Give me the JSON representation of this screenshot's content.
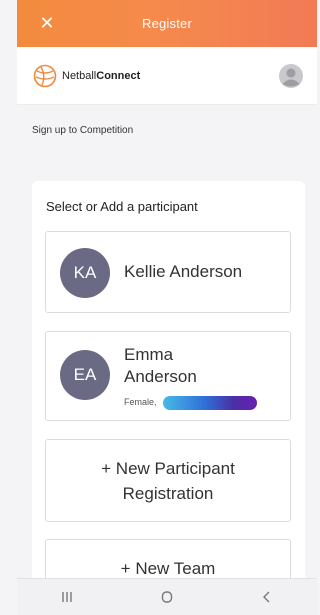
{
  "app": {
    "title": "Register",
    "close_icon": "close-icon"
  },
  "header": {
    "brand_plain": "Netball",
    "brand_bold": "Connect",
    "avatar_icon": "user-avatar-icon"
  },
  "subheading": "Sign up to Competition",
  "panel": {
    "title": "Select or Add a participant",
    "participants": [
      {
        "initials": "KA",
        "name": "Kellie Anderson",
        "avatar_color": "#6b6a85"
      },
      {
        "initials": "EA",
        "name": "Emma Anderson",
        "gender": "Female,",
        "avatar_color": "#6b6a85"
      }
    ],
    "new_participant": "+ New Participant Registration",
    "new_team": "+ New Team"
  },
  "nav": {
    "recents": "recents-icon",
    "home": "home-icon",
    "back": "back-icon"
  },
  "colors": {
    "accent_start": "#f38b3d",
    "accent_end": "#f27a57",
    "avatar": "#6b6a85"
  }
}
